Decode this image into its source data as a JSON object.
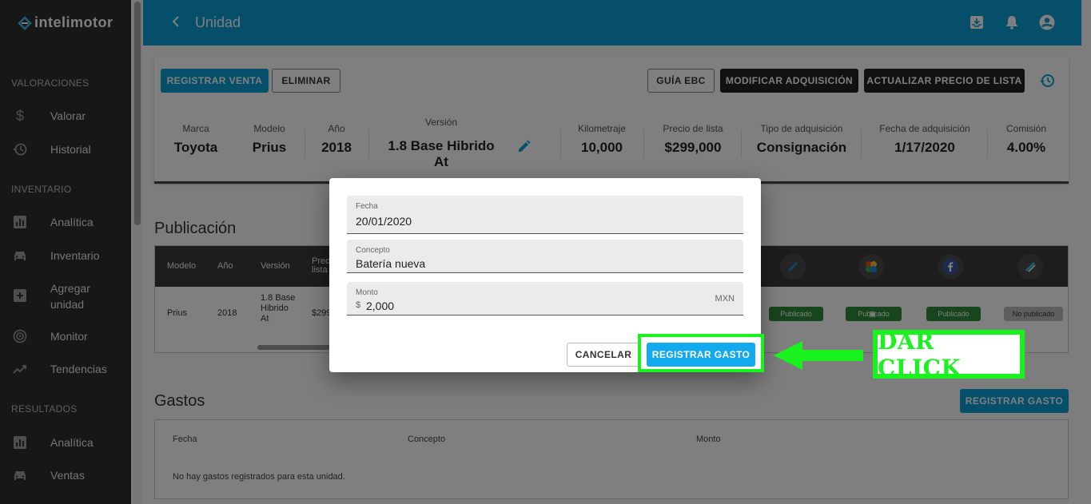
{
  "app": {
    "logo_text": "intelimotor"
  },
  "sidebar": {
    "sections": [
      {
        "title": "VALORACIONES"
      },
      {
        "title": "INVENTARIO"
      },
      {
        "title": "RESULTADOS"
      }
    ],
    "items": [
      {
        "label": "Valorar",
        "icon": "dollar-icon"
      },
      {
        "label": "Historial",
        "icon": "history-icon"
      },
      {
        "label": "Analítica",
        "icon": "bar-chart-icon"
      },
      {
        "label": "Inventario",
        "icon": "car-icon"
      },
      {
        "label": "Agregar unidad",
        "icon": "add-box-icon"
      },
      {
        "label": "Monitor",
        "icon": "radar-icon"
      },
      {
        "label": "Tendencias",
        "icon": "trending-icon"
      },
      {
        "label": "Analítica",
        "icon": "bar-chart-icon"
      },
      {
        "label": "Ventas",
        "icon": "car-icon"
      }
    ]
  },
  "topbar": {
    "title": "Unidad"
  },
  "unit_card": {
    "buttons": {
      "register_sale": "REGISTRAR VENTA",
      "delete": "ELIMINAR",
      "ebc_guide": "GUÍA EBC",
      "modify_acquisition": "MODIFICAR ADQUISICIÓN",
      "update_list_price": "ACTUALIZAR PRECIO DE LISTA"
    },
    "specs": [
      {
        "label": "Marca",
        "value": "Toyota"
      },
      {
        "label": "Modelo",
        "value": "Prius"
      },
      {
        "label": "Año",
        "value": "2018"
      },
      {
        "label": "Versión",
        "value": "1.8 Base Hibrido At"
      },
      {
        "label": "Kilometraje",
        "value": "10,000"
      },
      {
        "label": "Precio de lista",
        "value": "$299,000"
      },
      {
        "label": "Tipo de adquisición",
        "value": "Consignación"
      },
      {
        "label": "Fecha de adquisición",
        "value": "1/17/2020"
      },
      {
        "label": "Comisión",
        "value": "4.00%"
      }
    ]
  },
  "publication": {
    "title": "Publicación",
    "headers": [
      "Modelo",
      "Año",
      "Versión",
      "Precio lista"
    ],
    "row": {
      "modelo": "Prius",
      "anio": "2018",
      "version": "1.8 Base Hibrido At",
      "precio": "$299"
    },
    "statuses": [
      "Publicado",
      "Publicado",
      "Publicado",
      "No publicado"
    ]
  },
  "gastos": {
    "title": "Gastos",
    "register_button": "REGISTRAR GASTO",
    "headers": [
      "Fecha",
      "Concepto",
      "Monto"
    ],
    "empty_text": "No hay gastos registrados para esta unidad."
  },
  "dialog": {
    "fecha": {
      "label": "Fecha",
      "value": "20/01/2020"
    },
    "concepto": {
      "label": "Concepto",
      "value": "Batería nueva"
    },
    "monto": {
      "label": "Monto",
      "prefix": "$",
      "value": "2,000",
      "suffix": "MXN"
    },
    "cancel_label": "CANCELAR",
    "confirm_label": "REGISTRAR GASTO"
  },
  "annotation": {
    "text": "DAR CLICK",
    "color": "#19f21e"
  },
  "colors": {
    "primary": "#0a9fd6",
    "sidebar": "#2f2f2f",
    "published": "#2e8b3a"
  }
}
